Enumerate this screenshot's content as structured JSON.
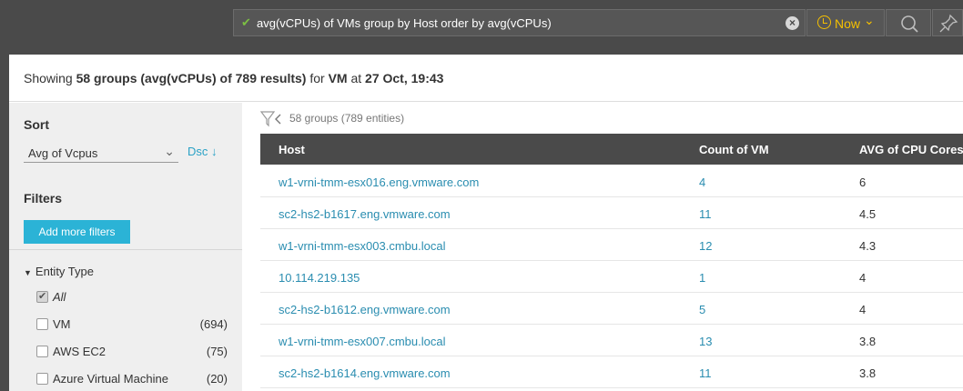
{
  "search": {
    "query": "avg(vCPUs) of VMs group by Host order by avg(vCPUs)",
    "time_label": "Now"
  },
  "summary": {
    "prefix": "Showing",
    "groups": "58 groups (avg(vCPUs) of 789 results)",
    "for": "for",
    "entity": "VM",
    "at": "at",
    "time": "27 Oct, 19:43"
  },
  "sidebar": {
    "sort_heading": "Sort",
    "sort_value": "Avg of Vcpus",
    "sort_dir": "Dsc",
    "filters_heading": "Filters",
    "add_filters": "Add more filters",
    "entity_type_label": "Entity Type",
    "filters": [
      {
        "label": "All",
        "count": "",
        "checked": true
      },
      {
        "label": "VM",
        "count": "(694)",
        "checked": false
      },
      {
        "label": "AWS EC2",
        "count": "(75)",
        "checked": false
      },
      {
        "label": "Azure Virtual Machine",
        "count": "(20)",
        "checked": false
      }
    ]
  },
  "results": {
    "groups_info": "58 groups (789 entities)",
    "columns": [
      "Host",
      "Count of VM",
      "AVG of CPU Cores"
    ],
    "rows": [
      [
        "w1-vrni-tmm-esx016.eng.vmware.com",
        "4",
        "6"
      ],
      [
        "sc2-hs2-b1617.eng.vmware.com",
        "11",
        "4.5"
      ],
      [
        "w1-vrni-tmm-esx003.cmbu.local",
        "12",
        "4.3"
      ],
      [
        "10.114.219.135",
        "1",
        "4"
      ],
      [
        "sc2-hs2-b1612.eng.vmware.com",
        "5",
        "4"
      ],
      [
        "w1-vrni-tmm-esx007.cmbu.local",
        "13",
        "3.8"
      ],
      [
        "sc2-hs2-b1614.eng.vmware.com",
        "11",
        "3.8"
      ]
    ]
  }
}
